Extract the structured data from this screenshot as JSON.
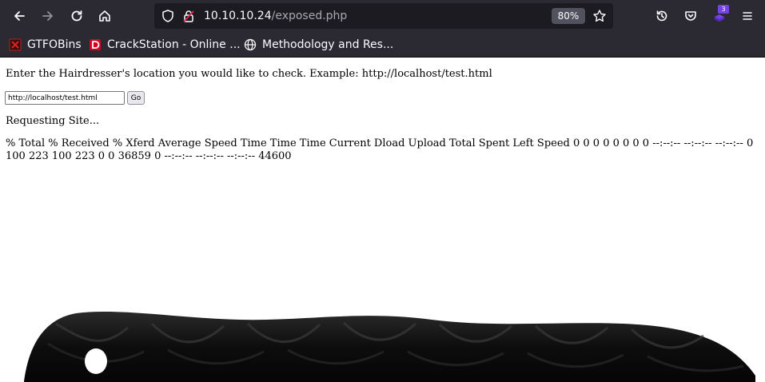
{
  "browser": {
    "url_host": "10.10.10.24",
    "url_path": "/exposed.php",
    "zoom": "80%",
    "extension_badge": "3",
    "icons": [
      "back-arrow-icon",
      "forward-arrow-icon",
      "reload-icon",
      "home-icon",
      "shield-icon",
      "insecure-lock-icon",
      "star-icon",
      "history-icon",
      "pocket-icon",
      "extension-icon",
      "menu-icon"
    ]
  },
  "bookmarks": [
    {
      "label": "GTFOBins",
      "icon": "gtfobins-icon"
    },
    {
      "label": "CrackStation - Online ...",
      "icon": "crackstation-icon"
    },
    {
      "label": "Methodology and Res...",
      "icon": "globe-icon"
    }
  ],
  "page": {
    "prompt": "Enter the Hairdresser's location you would like to check. Example: http://localhost/test.html",
    "input_value": "http://localhost/test.html",
    "go_label": "Go",
    "requesting": "Requesting Site...",
    "curl_output": "% Total % Received % Xferd Average Speed Time Time Time Current Dload Upload Total Spent Left Speed 0 0 0 0 0 0 0 0 --:--:-- --:--:-- --:--:-- 0 100 223 100 223 0 0 36859 0 --:--:-- --:--:-- --:--:-- 44600"
  },
  "colors": {
    "toolbar_bg": "#2b2a33",
    "urlbar_bg": "#1c1b22",
    "text_light": "#fbfbfe",
    "extension_purple": "#7542e5",
    "crackstation_red": "#d70022"
  }
}
